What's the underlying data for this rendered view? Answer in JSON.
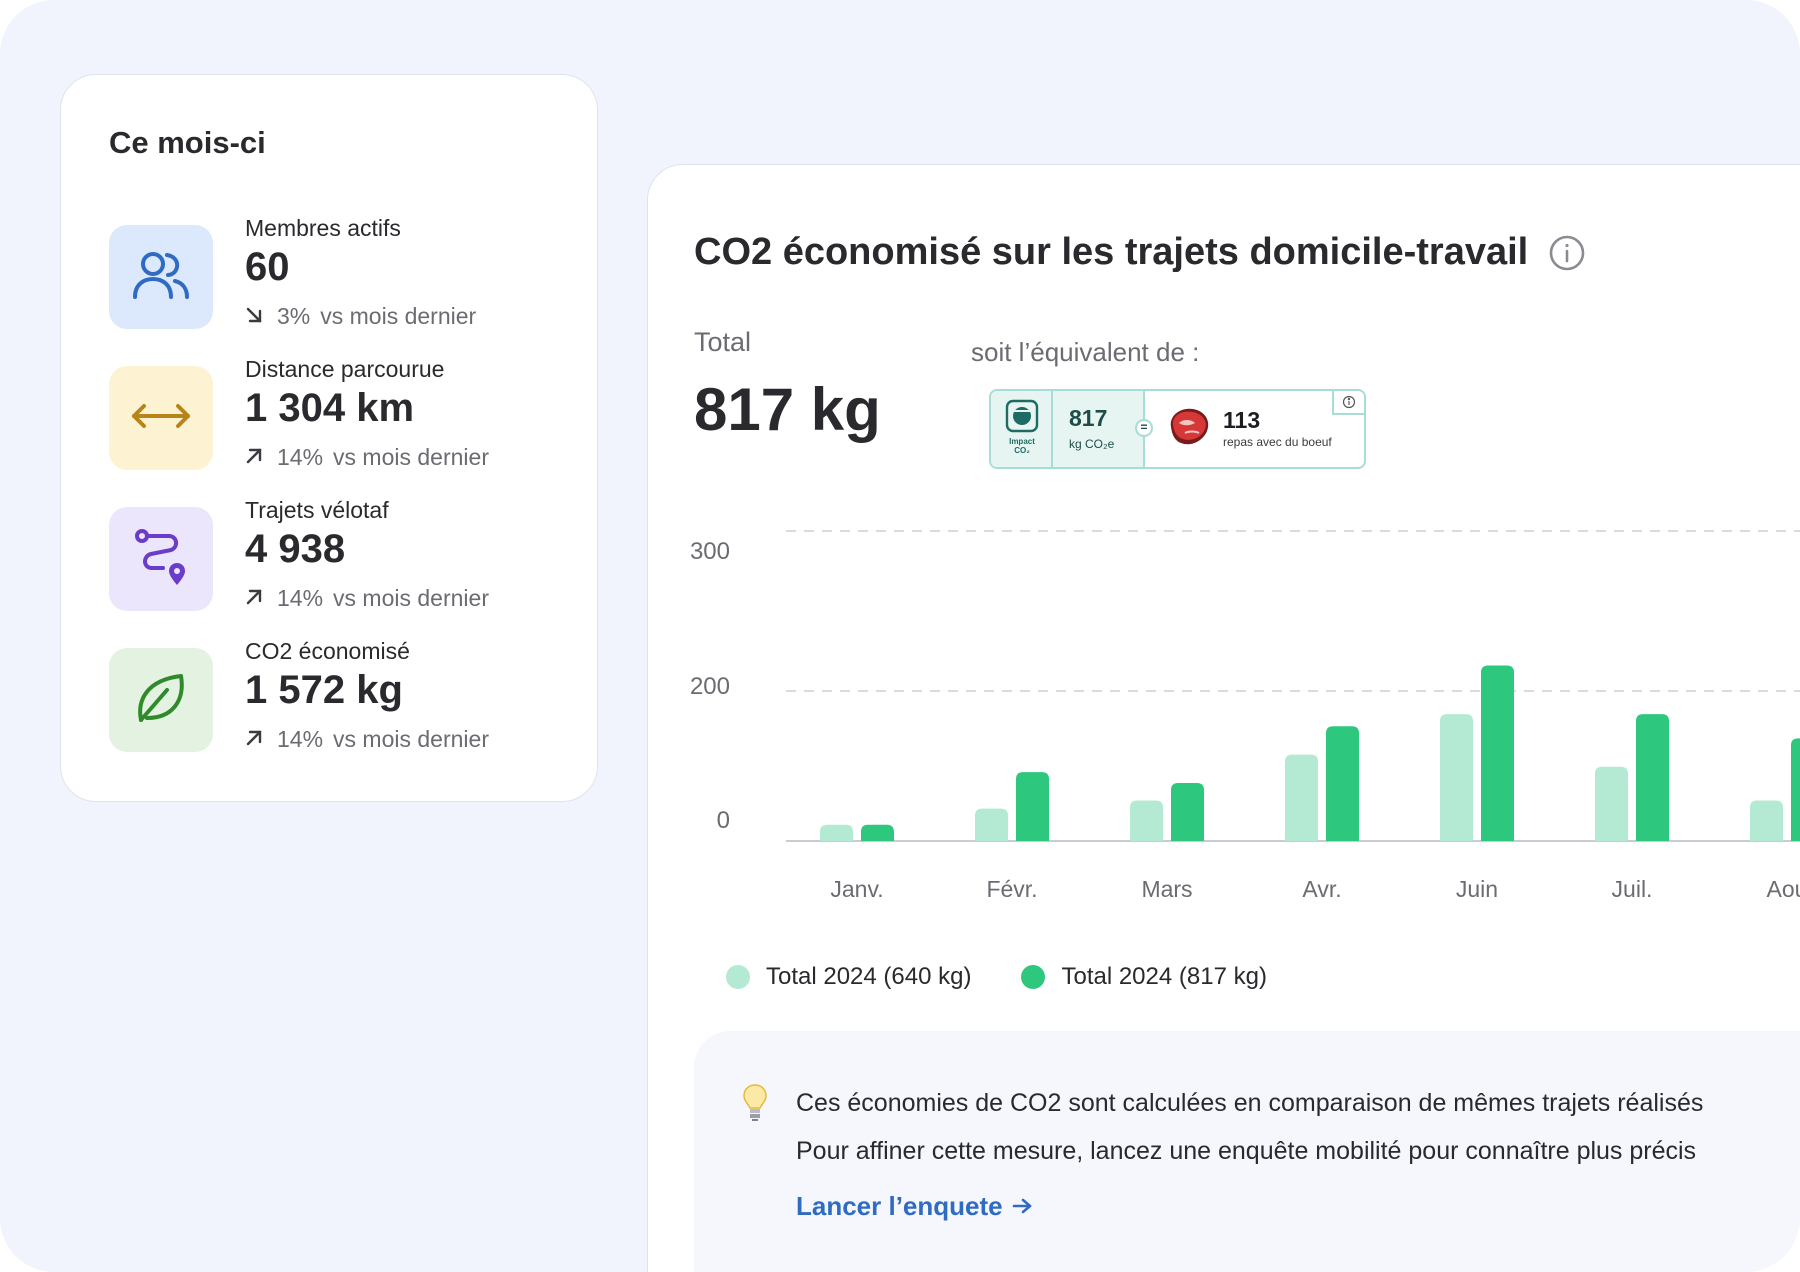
{
  "stats": {
    "title": "Ce mois-ci",
    "items": [
      {
        "label": "Membres actifs",
        "value": "60",
        "trend_dir": "down",
        "trend_pct": "3%",
        "trend_suffix": "vs mois dernier",
        "icon": "users-icon",
        "bg": "#dce8fb",
        "color": "#2f6cc1"
      },
      {
        "label": "Distance parcourue",
        "value": "1 304 km",
        "trend_dir": "up",
        "trend_pct": "14%",
        "trend_suffix": "vs mois dernier",
        "icon": "arrows-horizontal-icon",
        "bg": "#fdf3d2",
        "color": "#b88418"
      },
      {
        "label": "Trajets vélotaf",
        "value": "4 938",
        "trend_dir": "up",
        "trend_pct": "14%",
        "trend_suffix": "vs mois dernier",
        "icon": "route-icon",
        "bg": "#ebe6fb",
        "color": "#6a3cc9"
      },
      {
        "label": "CO2 économisé",
        "value": "1 572 kg",
        "trend_dir": "up",
        "trend_pct": "14%",
        "trend_suffix": "vs mois dernier",
        "icon": "leaf-icon",
        "bg": "#e3f2e1",
        "color": "#2f8a2c"
      }
    ]
  },
  "co2": {
    "title": "CO2 économisé sur les trajets domicile-travail",
    "total_label": "Total",
    "total_value": "817 kg",
    "equiv_label": "soit l’équivalent de :",
    "impact": {
      "logo_text_1": "Impact",
      "logo_text_2": "CO₂",
      "kg_value": "817",
      "kg_unit": "kg CO₂e",
      "eq_sign": "=",
      "meal_value": "113",
      "meal_label": "repas avec du boeuf"
    },
    "legend": [
      "Total 2024 (640 kg)",
      "Total 2024 (817 kg)"
    ],
    "tip": {
      "line1": "Ces économies de CO2 sont calculées en comparaison de mêmes trajets réalisés",
      "line2": "Pour affiner cette mesure, lancez une enquête mobilité pour connaître plus précis",
      "cta": "Lancer l’enquete"
    }
  },
  "colors": {
    "series_light": "#b4ead3",
    "series_dark": "#2ec77e",
    "accent_blue": "#2f6cc1",
    "grid": "#d9dbe0"
  },
  "chart_data": {
    "type": "bar",
    "categories": [
      "Janv.",
      "Févr.",
      "Mars",
      "Avr.",
      "Juin",
      "Juil.",
      "Aou"
    ],
    "y_tick_labels": [
      "300",
      "200",
      "0"
    ],
    "series": [
      {
        "name": "Total 2024 (640 kg)",
        "values": [
          12,
          24,
          30,
          64,
          94,
          55,
          30
        ]
      },
      {
        "name": "Total 2024 (817 kg)",
        "values": [
          12,
          51,
          43,
          85,
          130,
          94,
          76
        ]
      }
    ],
    "grid": true,
    "legend_position": "bottom-left"
  }
}
